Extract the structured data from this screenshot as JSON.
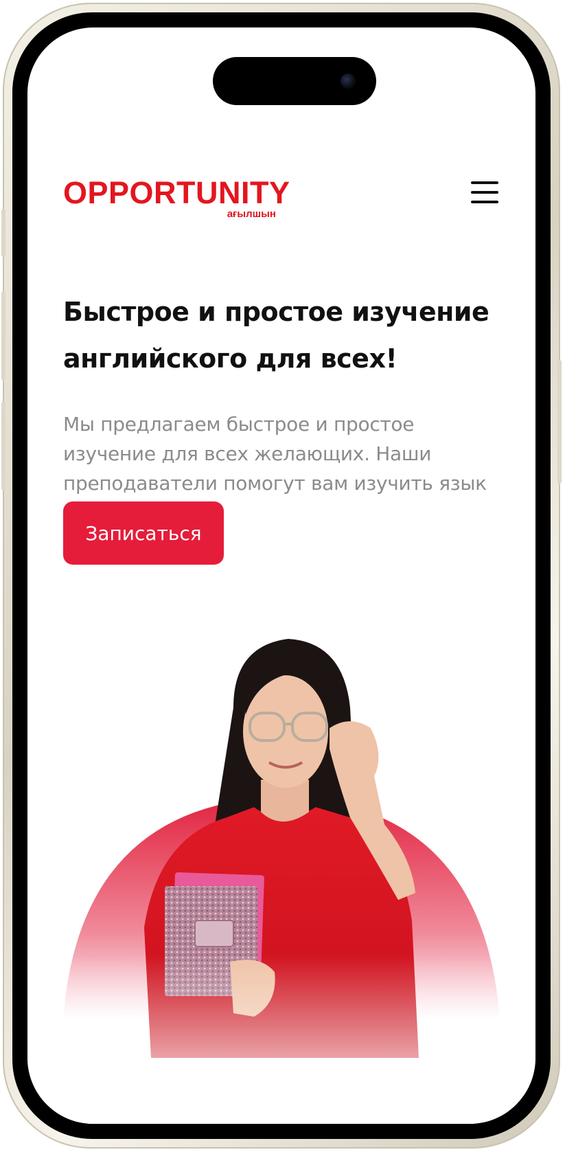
{
  "logo": {
    "main": "OPPORTUNITY",
    "sub": "ағылшын"
  },
  "header": {
    "menu_icon": "hamburger-menu-icon"
  },
  "hero": {
    "title": "Быстрое и простое изучение английского для всех!",
    "text": "Мы предлагаем быстрое и простое изучение для всех желающих. Наши преподаватели помогут вам изучить язык",
    "cta_label": "Записаться",
    "image": "woman-with-glasses-holding-notebooks"
  },
  "colors": {
    "brand_red": "#e3161f",
    "cta_red": "#e51d3a",
    "text_dark": "#111111",
    "text_muted": "#8b8b8b"
  }
}
